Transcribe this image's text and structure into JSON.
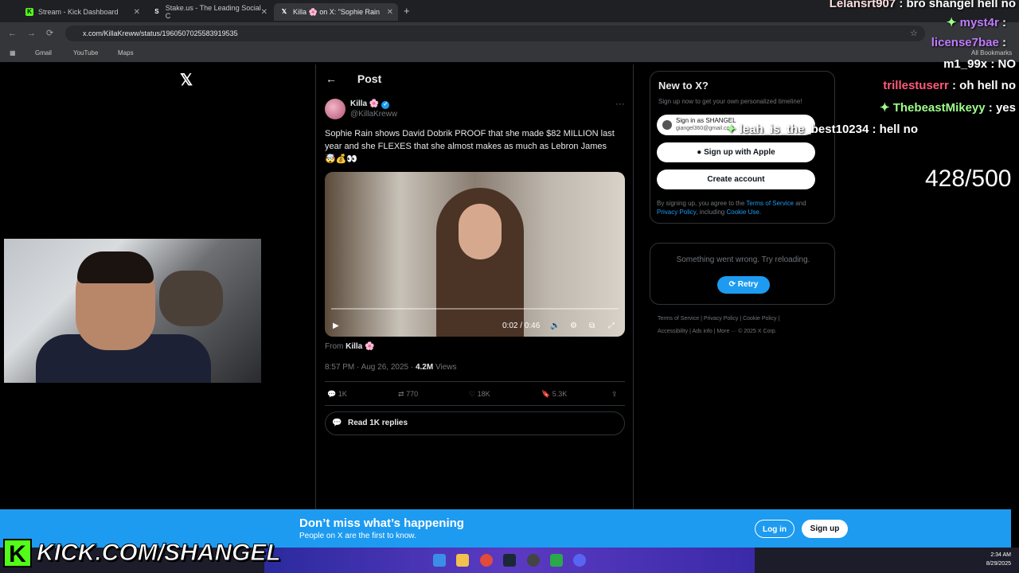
{
  "browser": {
    "tabs": [
      {
        "title": "Stream - Kick Dashboard"
      },
      {
        "title": "Stake.us - The Leading Social C"
      },
      {
        "title": "Killa 🌸 on X: \"Sophie Rain"
      }
    ],
    "url": "x.com/KillaKreww/status/1960507025583919535",
    "bookmarks": [
      "Gmail",
      "YouTube",
      "Maps"
    ],
    "all_bookmarks": "All Bookmarks"
  },
  "post": {
    "header": "Post",
    "author_name": "Killa 🌸",
    "author_handle": "@KillaKreww",
    "text": "Sophie Rain shows David Dobrik PROOF that she made $82 MILLION last year and she FLEXES that she almost makes as much as Lebron James 🤯💰👀",
    "video_time": "0:02 / 0:46",
    "from_label": "From",
    "from_name": "Killa 🌸",
    "timestamp": "8:57 PM · Aug 26, 2025 ·",
    "views_count": "4.2M",
    "views_label": "Views",
    "replies": "1K",
    "reposts": "770",
    "likes": "18K",
    "bookmarks": "5.3K",
    "read_replies": "Read 1K replies"
  },
  "signup": {
    "title": "New to X?",
    "subtitle": "Sign up now to get your own personalized timeline!",
    "google_name": "Sign in as SHANGEL",
    "google_email": "giangel360@gmail.com",
    "apple": "Sign up with Apple",
    "create": "Create account",
    "terms_pre": "By signing up, you agree to the",
    "terms_link": "Terms of Service",
    "terms_and": "and",
    "privacy_link": "Privacy Policy",
    "terms_mid": ", including",
    "cookie_link": "Cookie Use."
  },
  "error": {
    "message": "Something went wrong. Try reloading.",
    "retry": "Retry"
  },
  "footer": {
    "row1": "Terms of Service  |  Privacy Policy  |  Cookie Policy  |",
    "row2": "Accessibility  |  Ads info  |  More ···  © 2025 X Corp."
  },
  "chat": [
    {
      "user": "Lelansrt907",
      "msg": ": bro shangel hell no",
      "color": "#ffe0e0"
    },
    {
      "user": "myst4r",
      "msg": ":",
      "color": "#c07bff"
    },
    {
      "user": "license7bae",
      "msg": ":",
      "color": "#c07bff"
    },
    {
      "user": "m1_99x",
      "msg": ": NO",
      "color": "#ffffff"
    },
    {
      "user": "trillestuserr",
      "msg": ": oh hell no",
      "color": "#ff5a7a"
    },
    {
      "user": "ThebeastMikeyy",
      "msg": ": yes",
      "color": "#9eff8a"
    },
    {
      "user": "leah_is_the_best10234",
      "msg": ": hell no",
      "color": "#ffffff"
    }
  ],
  "counter": "428/500",
  "banner": {
    "title": "Don’t miss what’s happening",
    "subtitle": "People on X are the first to know.",
    "login": "Log in",
    "signup": "Sign up"
  },
  "overlay": {
    "kick_url": "KICK.COM/SHANGEL"
  },
  "taskbar": {
    "time": "2:34 AM",
    "date": "8/29/2025"
  },
  "colors": {
    "x_blue": "#1d9bf0",
    "kick_green": "#53fc18"
  }
}
